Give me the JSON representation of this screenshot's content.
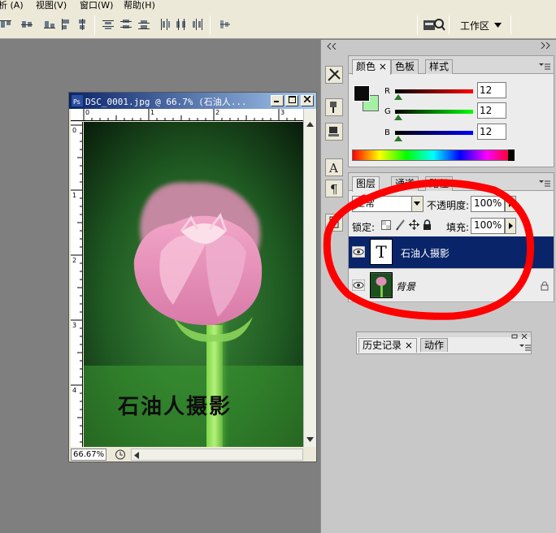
{
  "menubar": {
    "items": [
      "析 (A)",
      "视图(V)",
      "窗口(W)",
      "帮助(H)"
    ]
  },
  "optionsbar": {
    "workspace_label": "工作区"
  },
  "document": {
    "title": "DSC_0001.jpg @ 66.7% (石油人...",
    "zoom": "66.67%",
    "ruler_top": [
      "0",
      "1",
      "2",
      "3"
    ],
    "ruler_left": [
      "0",
      "1",
      "2",
      "3",
      "4"
    ],
    "watermark_text": "石油人摄影"
  },
  "color_panel": {
    "tabs": [
      "颜色",
      "色板",
      "样式"
    ],
    "r_label": "R",
    "g_label": "G",
    "b_label": "B",
    "r_value": "12",
    "g_value": "12",
    "b_value": "12",
    "foreground": "#0c0c0c",
    "background": "#a6f0a6"
  },
  "layers_panel": {
    "tabs": [
      "图层",
      "通道",
      "路径"
    ],
    "blend_mode": "正常",
    "opacity_label": "不透明度:",
    "opacity_value": "100%",
    "lock_label": "锁定:",
    "fill_label": "填充:",
    "fill_value": "100%",
    "layers": [
      {
        "name": "石油人摄影",
        "type": "text",
        "thumb_letter": "T",
        "selected": true
      },
      {
        "name": "背景",
        "type": "image",
        "selected": false
      }
    ]
  },
  "history_panel": {
    "tabs": [
      "历史记录",
      "动作"
    ]
  },
  "accent": {
    "selection": "#0a246a",
    "annotation": "#ff0000"
  }
}
